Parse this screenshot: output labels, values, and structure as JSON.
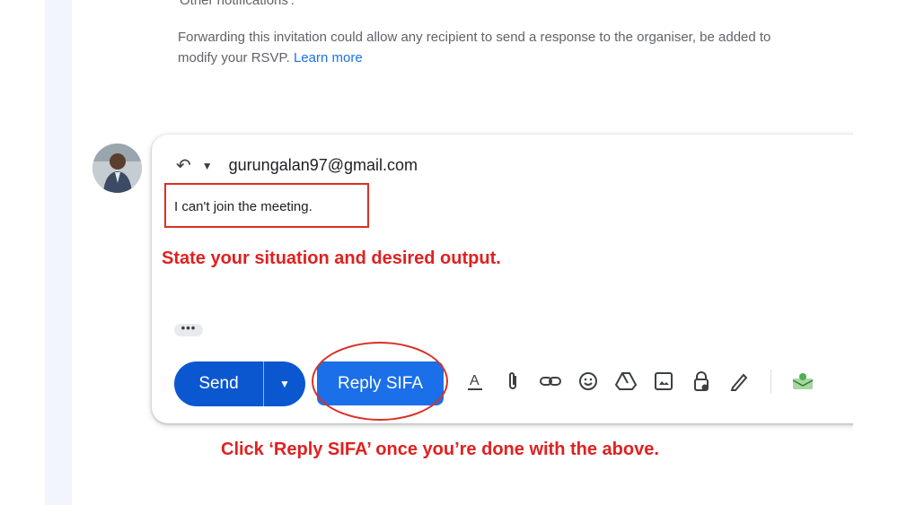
{
  "thread": {
    "cut_heading": "Other notifications'.",
    "forward_note": "Forwarding this invitation could allow any recipient to send a response to the organiser, be added to",
    "forward_note_2": "modify your RSVP.",
    "learn_more": "Learn more"
  },
  "composer": {
    "reply_icon": "reply-arrow-icon",
    "recipient": "gurungalan97@gmail.com",
    "body_text": "I can't join the meeting.",
    "more_dots": "•••",
    "send_label": "Send",
    "reply_sifa_label": "Reply SIFA",
    "toolbar_icons": [
      "text-format-icon",
      "attach-icon",
      "link-icon",
      "emoji-icon",
      "drive-icon",
      "image-icon",
      "confidential-icon",
      "signature-icon",
      "addon-icon"
    ]
  },
  "annotations": {
    "situation": "State your situation and desired output.",
    "click_hint": "Click ‘Reply SIFA’ once you’re done with the above."
  },
  "colors": {
    "annotation_red": "#e02020",
    "send_blue": "#0b57d0",
    "sifa_blue": "#1b6fe8"
  }
}
